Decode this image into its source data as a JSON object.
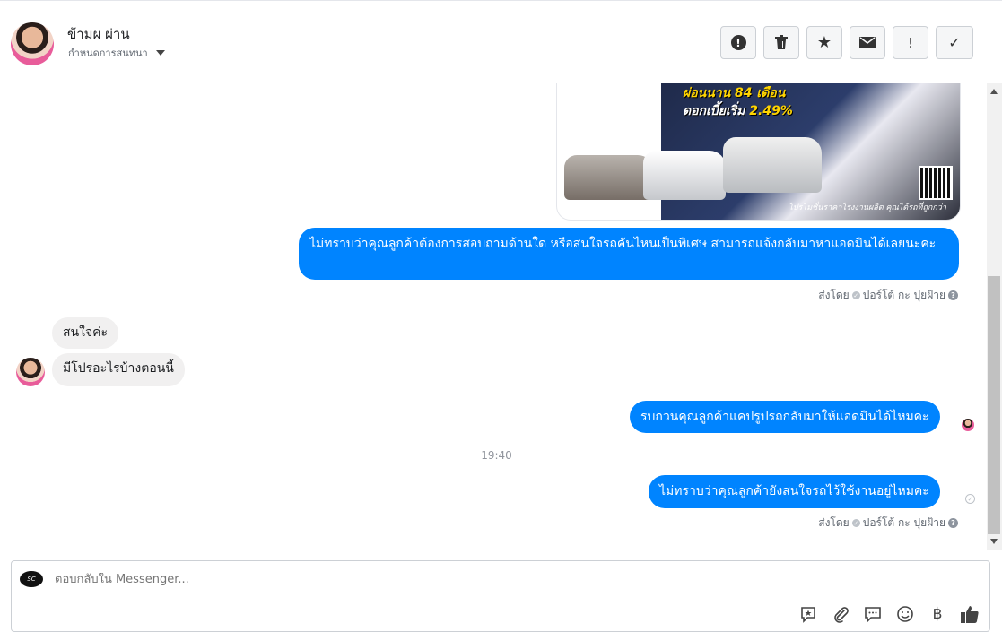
{
  "header": {
    "contact_name": "ข้ามผ ผ่าน",
    "assign_label": "กำหนดการสนทนา",
    "actions": {
      "report": "!",
      "delete": "🗑",
      "star": "★",
      "mail": "✉",
      "spam": "!",
      "done": "✓"
    }
  },
  "promo_image": {
    "line1": "ผ่อนนาน 84 เดือน",
    "line2_prefix": "ดอกเบี้ยเริ่ม",
    "line2_rate": "2.49%",
    "footer": "โปรโมชั่นราคาโรงงานผลิต คุณได้รถที่ถูกกว่า"
  },
  "messages": [
    {
      "id": "m1",
      "direction": "out",
      "text": "ไม่ทราบว่าคุณลูกค้าต้องการสอบถามด้านใด หรือสนใจรถคันไหนเป็นพิเศษ สามารถแจ้งกลับมาหาแอดมินได้เลยนะคะ"
    },
    {
      "id": "m2",
      "direction": "in",
      "text": "สนใจค่ะ"
    },
    {
      "id": "m3",
      "direction": "in",
      "text": "มีโปรอะไรบ้างตอนนี้"
    },
    {
      "id": "m4",
      "direction": "out",
      "text": "รบกวนคุณลูกค้าแคปรูปรถกลับมาให้แอดมินได้ไหมคะ"
    },
    {
      "id": "m5",
      "direction": "out",
      "text": "ไม่ทราบว่าคุณลูกค้ายังสนใจรถไว้ใช้งานอยู่ไหมคะ"
    }
  ],
  "sent_by": {
    "prefix": "ส่งโดย",
    "agent": "ปอร์โต้ กะ ปุยฝ้าย"
  },
  "time_separator": "19:40",
  "composer": {
    "placeholder": "ตอบกลับใน Messenger...",
    "tools": [
      "saved-reply-icon",
      "attach-icon",
      "message-icon",
      "emoji-icon",
      "payment-icon",
      "like-icon"
    ]
  },
  "colors": {
    "outgoing_bubble": "#0084ff",
    "incoming_bubble": "#f1f0f0"
  }
}
